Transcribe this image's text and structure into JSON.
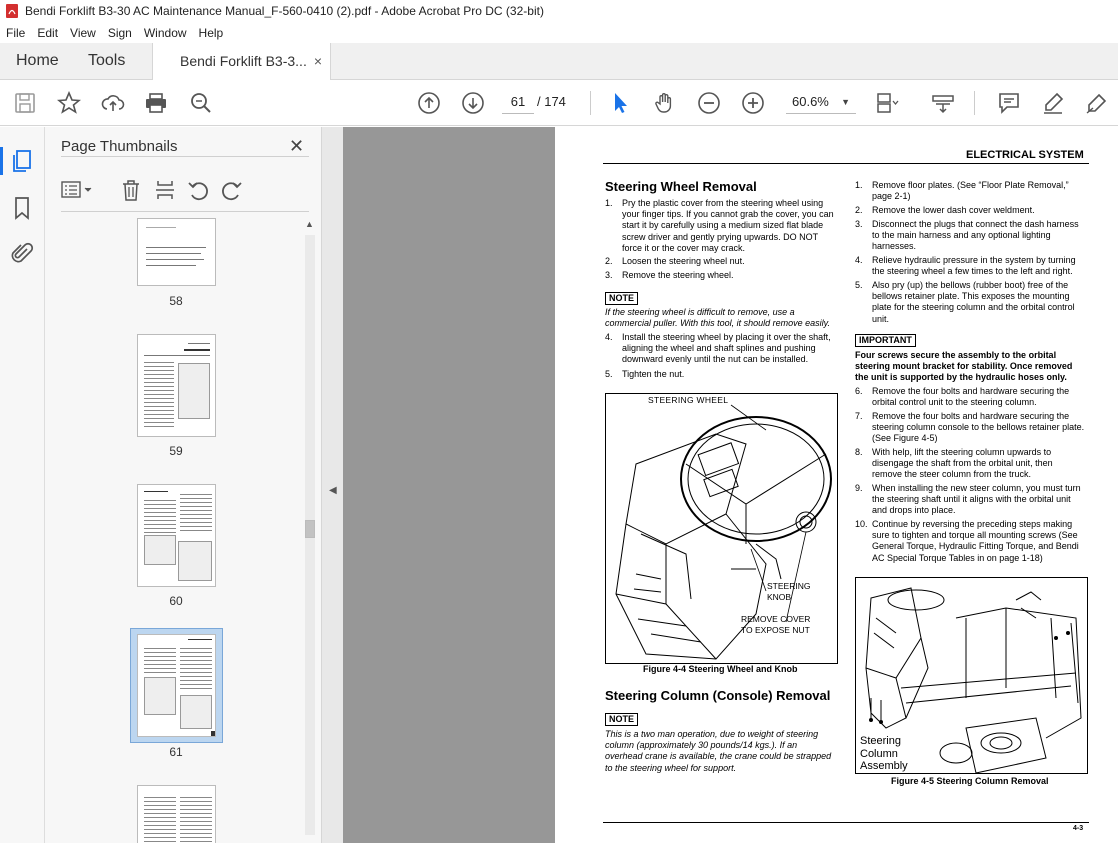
{
  "window": {
    "title": "Bendi Forklift B3-30 AC Maintenance Manual_F-560-0410 (2).pdf - Adobe Acrobat Pro DC (32-bit)"
  },
  "menu": [
    "File",
    "Edit",
    "View",
    "Sign",
    "Window",
    "Help"
  ],
  "tabs": {
    "home": "Home",
    "tools": "Tools",
    "doc": "Bendi Forklift B3-3...",
    "close": "×"
  },
  "toolbar": {
    "page_current": "61",
    "page_total": "/ 174",
    "zoom": "60.6%"
  },
  "panel": {
    "title": "Page Thumbnails",
    "close": "✕",
    "thumbs": [
      {
        "label": "58"
      },
      {
        "label": "59"
      },
      {
        "label": "60"
      },
      {
        "label": "61",
        "selected": true
      }
    ]
  },
  "doc": {
    "header": "ELECTRICAL SYSTEM",
    "left": {
      "h_wheel": "Steering Wheel Removal",
      "steps_a": [
        {
          "n": "1.",
          "t": [
            "Pry the plastic cover from the steering wheel using",
            "your finger tips. If you cannot grab the cover, you can",
            "start it by carefully using a medium sized flat blade",
            "screw driver and gently prying upwards. DO NOT",
            "force it or the cover may crack."
          ]
        },
        {
          "n": "2.",
          "t": [
            "Loosen the steering wheel nut."
          ]
        },
        {
          "n": "3.",
          "t": [
            "Remove the steering wheel."
          ]
        }
      ],
      "note1_tag": "NOTE",
      "note1": [
        "If the steering wheel is difficult to remove, use a",
        "commercial puller. With this tool, it should remove easily."
      ],
      "steps_b": [
        {
          "n": "4.",
          "t": [
            "Install the steering wheel by placing it over the shaft,",
            "aligning the wheel and shaft splines and pushing",
            "downward evenly until the nut can be installed."
          ]
        },
        {
          "n": "5.",
          "t": [
            "Tighten the nut."
          ]
        }
      ],
      "fig4_labels": {
        "wheel": "STEERING WHEEL",
        "knob1": "STEERING",
        "knob2": "KNOB",
        "cover1": "REMOVE COVER",
        "cover2": "TO EXPOSE NUT"
      },
      "fig4_caption": "Figure 4-4 Steering Wheel and Knob",
      "h_column": "Steering Column (Console) Removal",
      "note2_tag": "NOTE",
      "note2": [
        "This is a two man operation, due to weight of steering",
        "column (approximately 30 pounds/14 kgs.). If an",
        "overhead crane is available, the crane could be strapped",
        "to the steering wheel for support."
      ]
    },
    "right": {
      "steps_a": [
        {
          "n": "1.",
          "t": [
            "Remove floor plates. (See “Floor Plate Removal,”",
            "page 2-1)"
          ]
        },
        {
          "n": "2.",
          "t": [
            "Remove the lower dash cover weldment."
          ]
        },
        {
          "n": "3.",
          "t": [
            "Disconnect the plugs that connect the dash harness",
            "to the main harness and any optional lighting",
            "harnesses."
          ]
        },
        {
          "n": "4.",
          "t": [
            "Relieve hydraulic pressure in the system by turning",
            "the steering wheel a few times to the left and right."
          ]
        },
        {
          "n": "5.",
          "t": [
            "Also pry (up) the bellows (rubber boot) free of the",
            "bellows retainer plate. This exposes the mounting",
            "plate for the steering column and the orbital control",
            "unit."
          ]
        }
      ],
      "important_tag": "IMPORTANT",
      "important": [
        "Four screws secure the assembly to the orbital",
        "steering mount bracket for stability. Once removed",
        "the unit is supported by the hydraulic hoses only."
      ],
      "steps_b": [
        {
          "n": "6.",
          "t": [
            "Remove the four bolts and hardware securing the",
            "orbital control unit to the steering column."
          ]
        },
        {
          "n": "7.",
          "t": [
            "Remove the four bolts and hardware securing the",
            "steering column console to the bellows retainer plate.",
            "(See Figure 4-5)"
          ]
        },
        {
          "n": "8.",
          "t": [
            "With help, lift the steering column upwards to",
            "disengage the shaft from the orbital unit, then",
            "remove the steer column from the truck."
          ]
        },
        {
          "n": "9.",
          "t": [
            "When installing the new steer column, you must turn",
            "the steering shaft until it aligns with the orbital unit",
            "and drops into place."
          ]
        },
        {
          "n": "10.",
          "t": [
            "Continue by reversing the preceding steps making",
            "sure to tighten and torque all mounting screws (See",
            "General Torque, Hydraulic Fitting Torque, and Bendi",
            "AC Special Torque Tables in on page 1-18)"
          ]
        }
      ],
      "fig5_labels": [
        "Steering",
        "Column",
        "Assembly"
      ],
      "fig5_caption": "Figure 4-5 Steering Column Removal"
    },
    "page_number": "4-3"
  }
}
